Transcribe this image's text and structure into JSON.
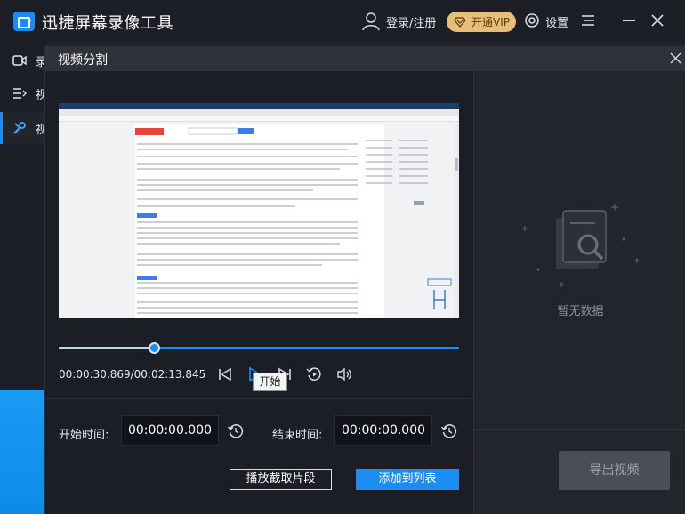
{
  "app": {
    "title": "迅捷屏幕录像工具",
    "login_label": "登录/注册",
    "vip_label": "开通VIP",
    "settings_label": "设置"
  },
  "sidebar": {
    "items": [
      {
        "label": "录",
        "icon": "camera-icon"
      },
      {
        "label": "视",
        "icon": "list-icon"
      },
      {
        "label": "视",
        "icon": "edit-tools-icon",
        "active": true
      }
    ]
  },
  "dialog": {
    "title": "视频分割",
    "timecode": "00:00:30.869/00:02:13.845",
    "progress_fraction": 0.237,
    "tooltip": "开始",
    "start_label": "开始时间:",
    "start_value": "00:00:00.000",
    "end_label": "结束时间:",
    "end_value": "00:00:00.000",
    "play_clip_label": "播放截取片段",
    "add_to_list_label": "添加到列表",
    "empty_text": "暂无数据",
    "export_label": "导出视频"
  },
  "colors": {
    "accent": "#1b8df2",
    "vip_gold": "#e7bf79",
    "dialog_bg": "#272932",
    "panel_bg": "#1c1e25"
  }
}
